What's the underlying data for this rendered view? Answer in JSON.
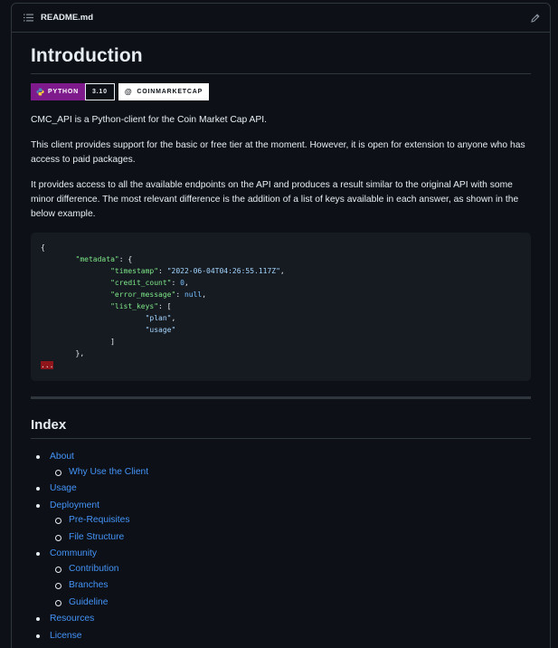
{
  "header": {
    "file_name": "README.md"
  },
  "intro": {
    "title": "Introduction",
    "badge_python_label": "PYTHON",
    "badge_python_version": "3.10",
    "badge_cmc_label": "COINMARKETCAP",
    "paragraphs": [
      "CMC_API is a Python-client for the Coin Market Cap API.",
      "This client provides support for the basic or free tier at the moment. However, it is open for extension to anyone who has access to paid packages.",
      "It provides access to all the available endpoints on the API and produces a result similar to the original API with some minor difference. The most relevant difference is the addition of a list of keys available in each answer, as shown in the below example."
    ]
  },
  "code": {
    "open_brace": "{",
    "metadata_key": "\"metadata\"",
    "timestamp_key": "\"timestamp\"",
    "timestamp_val": "\"2022-06-04T04:26:55.117Z\"",
    "credit_key": "\"credit_count\"",
    "credit_val": "0",
    "error_key": "\"error_message\"",
    "error_val": "null",
    "list_keys_key": "\"list_keys\"",
    "plan_val": "\"plan\"",
    "usage_val": "\"usage\"",
    "ellipsis": "..."
  },
  "index": {
    "title": "Index",
    "items": [
      {
        "label": "About",
        "sub": [
          "Why Use the Client"
        ]
      },
      {
        "label": "Usage",
        "sub": []
      },
      {
        "label": "Deployment",
        "sub": [
          "Pre-Requisites",
          "File Structure"
        ]
      },
      {
        "label": "Community",
        "sub": [
          "Contribution",
          "Branches",
          "Guideline"
        ]
      },
      {
        "label": "Resources",
        "sub": []
      },
      {
        "label": "License",
        "sub": []
      }
    ]
  }
}
